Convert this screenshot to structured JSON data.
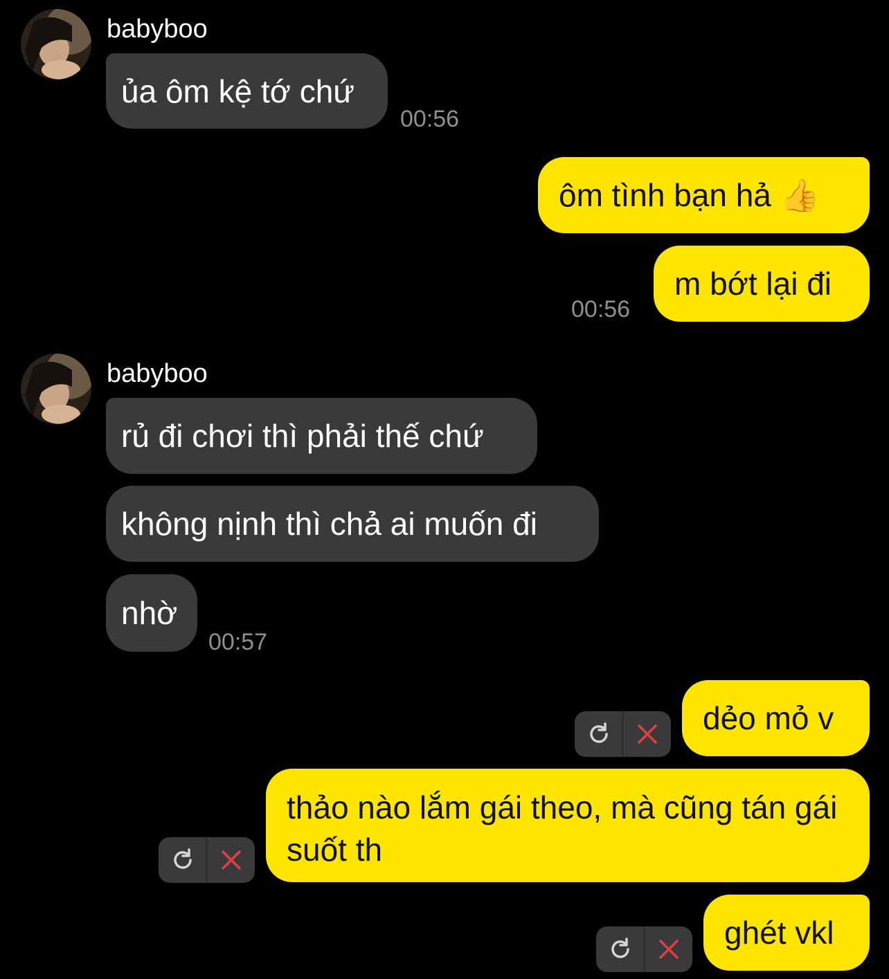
{
  "conversation": {
    "sender_name": "babyboo",
    "groups": [
      {
        "direction": "incoming",
        "sender": "babyboo",
        "messages": [
          "ủa ôm kệ tớ chứ"
        ],
        "time": "00:56"
      },
      {
        "direction": "outgoing",
        "messages": [
          "ôm tình bạn hả 👍",
          "m bớt lại đi"
        ],
        "time": "00:56"
      },
      {
        "direction": "incoming",
        "sender": "babyboo",
        "messages": [
          "rủ đi chơi thì phải thế chứ",
          "không nịnh thì chả ai muốn đi",
          "nhờ"
        ],
        "time": "00:57"
      },
      {
        "direction": "outgoing",
        "status": "failed",
        "messages": [
          "dẻo mỏ v",
          "thảo nào lắm gái theo, mà cũng tán gái suốt th",
          "ghét vkl"
        ]
      }
    ]
  },
  "icons": {
    "retry": "retry-icon",
    "delete": "delete-icon",
    "thumbs_up": "thumbs-up-emoji"
  },
  "colors": {
    "background": "#000000",
    "incoming_bubble": "#3a3a3c",
    "outgoing_bubble": "#fee500",
    "timestamp": "#8e8e93",
    "delete_icon": "#e0403f",
    "retry_icon": "#d6d6d6"
  }
}
